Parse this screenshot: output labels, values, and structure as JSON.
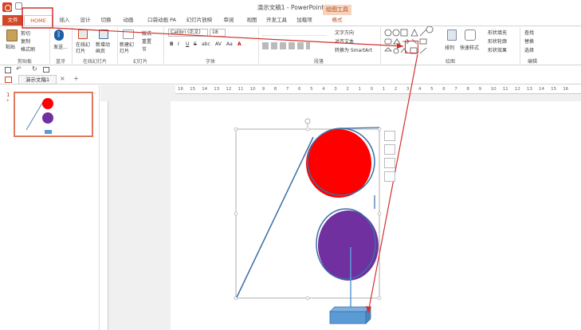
{
  "app": {
    "title": "演示文稿1 - PowerPoint",
    "context_header": "绘图工具"
  },
  "tabs": [
    {
      "label": "文件"
    },
    {
      "label": "HOME"
    },
    {
      "label": "插入"
    },
    {
      "label": "设计"
    },
    {
      "label": "切换"
    },
    {
      "label": "动画"
    },
    {
      "label": "口袋动画 PA"
    },
    {
      "label": "幻灯片放映"
    },
    {
      "label": "审阅"
    },
    {
      "label": "视图"
    },
    {
      "label": "开发工具"
    },
    {
      "label": "加载项"
    },
    {
      "label": "格式"
    }
  ],
  "ribbon": {
    "clipboard": {
      "paste": "粘贴",
      "cut": "剪切",
      "copy": "复制",
      "painter": "格式刷",
      "label": "剪贴板"
    },
    "bluetooth": {
      "send": "发送...",
      "label": "蓝牙"
    },
    "online": {
      "online": "在线幻灯片",
      "new": "新增动画页",
      "label": "在线幻灯片"
    },
    "slides": {
      "new": "新建幻灯片",
      "layout": "版式",
      "reset": "重置",
      "section": "节",
      "label": "幻灯片"
    },
    "font": {
      "name": "Calibri (正文)",
      "size": "18",
      "bold": "B",
      "italic": "I",
      "underline": "U",
      "strike": "S",
      "shadow": "abc",
      "spacing": "AV",
      "case": "Aa",
      "color": "A",
      "label": "字体"
    },
    "paragraph": {
      "direction": "文字方向",
      "align": "对齐文本",
      "smartart": "转换为 SmartArt",
      "label": "段落"
    },
    "drawing": {
      "arrange": "排列",
      "quick_styles": "快速样式",
      "fill": "形状填充",
      "outline": "形状轮廓",
      "effects": "形状效果",
      "label": "绘图"
    },
    "editing": {
      "find": "查找",
      "replace": "替换",
      "select": "选择",
      "label": "编辑"
    }
  },
  "slide_tab": {
    "label": "演示文稿1"
  },
  "thumbnail": {
    "number": "1",
    "star": "*"
  },
  "ruler": {
    "h_ticks": [
      "16",
      "15",
      "14",
      "13",
      "12",
      "11",
      "10",
      "9",
      "8",
      "7",
      "6",
      "5",
      "4",
      "3",
      "2",
      "1",
      "0",
      "1",
      "2",
      "3",
      "4",
      "5",
      "6",
      "7",
      "8",
      "9",
      "10",
      "11",
      "12",
      "13",
      "14",
      "15",
      "16"
    ]
  },
  "colors": {
    "accent": "#d24726",
    "red_circle": "#ff0000",
    "purple_circle": "#7030a0",
    "base": "#5b9bd5",
    "line": "#3b6ea5",
    "annotation": "#d0312d"
  }
}
